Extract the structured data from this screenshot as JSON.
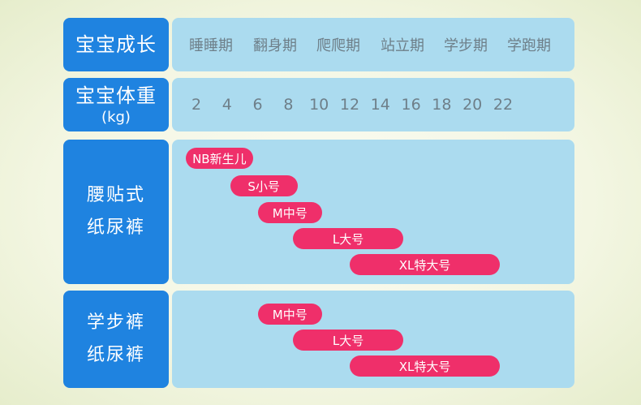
{
  "colors": {
    "label_bg": "#1f83e0",
    "panel_bg": "#abdbef",
    "bar": "#ef2f6a",
    "axis_text": "#6e7f89"
  },
  "header": {
    "stage_label": "宝宝成长",
    "weight_label": "宝宝体重",
    "weight_unit": "(kg)"
  },
  "sections": [
    {
      "line1": "腰贴式",
      "line2": "纸尿裤"
    },
    {
      "line1": "学步裤",
      "line2": "纸尿裤"
    }
  ],
  "chart_data": {
    "type": "bar",
    "subtype": "range (gantt-style)",
    "x_axis": {
      "label": "宝宝体重 (kg)",
      "ticks": [
        2,
        4,
        6,
        8,
        10,
        12,
        14,
        16,
        18,
        20,
        22
      ],
      "range": [
        2,
        22
      ]
    },
    "stages": [
      "睡睡期",
      "翻身期",
      "爬爬期",
      "站立期",
      "学步期",
      "学跑期"
    ],
    "groups": [
      {
        "name": "腰贴式纸尿裤",
        "sizes": [
          {
            "label": "NB新生儿",
            "start": 1.3,
            "end": 5.7
          },
          {
            "label": "S小号",
            "start": 4.2,
            "end": 8.6
          },
          {
            "label": "M中号",
            "start": 6.0,
            "end": 10.2
          },
          {
            "label": "L大号",
            "start": 8.3,
            "end": 15.5
          },
          {
            "label": "XL特大号",
            "start": 12.0,
            "end": 21.8
          }
        ]
      },
      {
        "name": "学步裤纸尿裤",
        "sizes": [
          {
            "label": "M中号",
            "start": 6.0,
            "end": 10.2
          },
          {
            "label": "L大号",
            "start": 8.3,
            "end": 15.5
          },
          {
            "label": "XL特大号",
            "start": 12.0,
            "end": 21.8
          }
        ]
      }
    ]
  }
}
